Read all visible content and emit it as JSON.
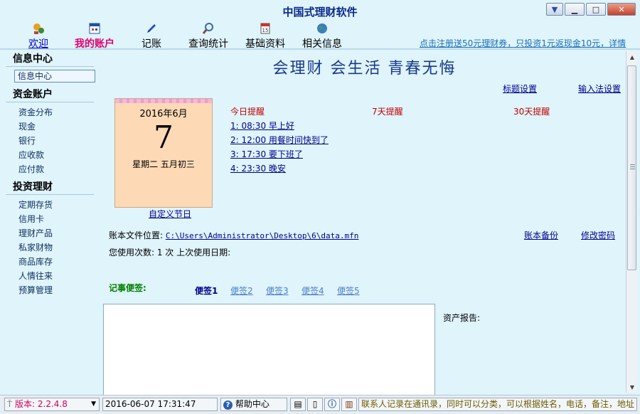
{
  "window": {
    "title": "中国式理财软件"
  },
  "toolbar": {
    "items": [
      {
        "label": "欢迎",
        "icon": "welcome-icon"
      },
      {
        "label": "我的账户",
        "icon": "account-icon"
      },
      {
        "label": "记账",
        "icon": "pen-icon"
      },
      {
        "label": "查询统计",
        "icon": "magnifier-icon"
      },
      {
        "label": "基础资料",
        "icon": "calendar-icon"
      },
      {
        "label": "相关信息",
        "icon": "globe-icon"
      }
    ],
    "promo": "点击注册送50元理财券，只投资1元返现金10元，详情"
  },
  "sidebar": {
    "sections": [
      {
        "title": "信息中心",
        "items": [
          "信息中心"
        ]
      },
      {
        "title": "资金账户",
        "items": [
          "资金分布",
          "现金",
          "银行",
          "应收款",
          "应付款"
        ]
      },
      {
        "title": "投资理财",
        "items": [
          "定期存货",
          "信用卡",
          "理财产品",
          "私家财物",
          "商品库存",
          "人情往来",
          "预算管理"
        ]
      }
    ]
  },
  "main": {
    "slogan": "会理财 会生活 青春无悔",
    "title_settings": "标题设置",
    "ime_settings": "输入法设置",
    "calendar": {
      "month": "2016年6月",
      "day": "7",
      "weekday_lunar": "星期二 五月初三"
    },
    "custom_holiday": "自定义节日",
    "reminders": {
      "today": "今日提醒",
      "seven_days": "7天提醒",
      "thirty_days": "30天提醒",
      "items": [
        "1: 08:30 早上好",
        "2: 12:00 用餐时间快到了",
        "3: 17:30 要下班了",
        "4: 23:30 晚安"
      ]
    },
    "file_label": "账本文件位置:",
    "file_path": "C:\\Users\\Administrator\\Desktop\\6\\data.mfn",
    "backup": "账本备份",
    "change_password": "修改密码",
    "usage": "您使用次数: 1 次    上次使用日期:",
    "memo_label": "记事便签:",
    "memo_tabs": [
      "便签1",
      "便签2",
      "便签3",
      "便签4",
      "便签5"
    ],
    "asset_report": "资产报告:"
  },
  "statusbar": {
    "version": "版本: 2.2.4.8",
    "datetime": "2016-06-07 17:31:47",
    "help": "帮助中心",
    "marquee": "联系人记录在通讯录，同时可以分类，可以根据姓名，电话，备注，地址"
  },
  "colors": {
    "background": "#dff4fb",
    "title": "#0a2a8a",
    "active_tab": "#e0006e",
    "reminder_header": "#c00000",
    "memo_label": "#008000"
  }
}
